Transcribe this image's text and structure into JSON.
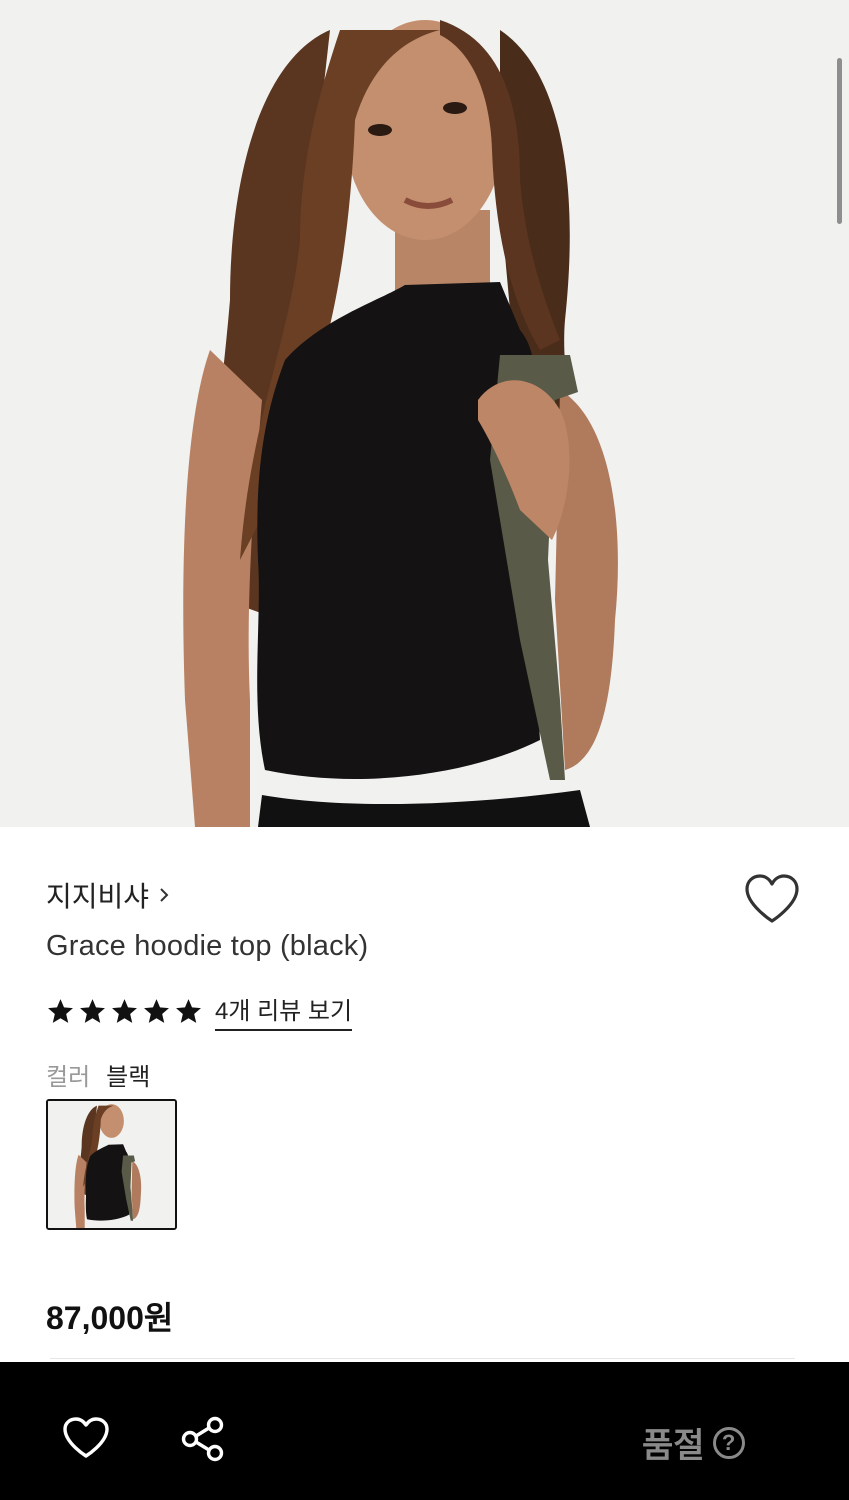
{
  "product": {
    "brand": "지지비샤",
    "title": "Grace hoodie top (black)",
    "rating_stars": 5,
    "review_link": "4개 리뷰 보기",
    "color_label": "컬러",
    "color_value": "블랙",
    "price": "87,000원"
  },
  "bottom_bar": {
    "status": "품절",
    "help_symbol": "?"
  },
  "icons": {
    "brand_chevron": "chevron-right-icon",
    "wishlist": "heart-outline-icon",
    "share": "share-icon",
    "star": "star-filled-icon",
    "help": "question-circle-icon"
  },
  "colors": {
    "bottom_bar_bg": "#000000",
    "soldout_text": "#8a8a8a",
    "photo_background": "#f1f1ef"
  }
}
